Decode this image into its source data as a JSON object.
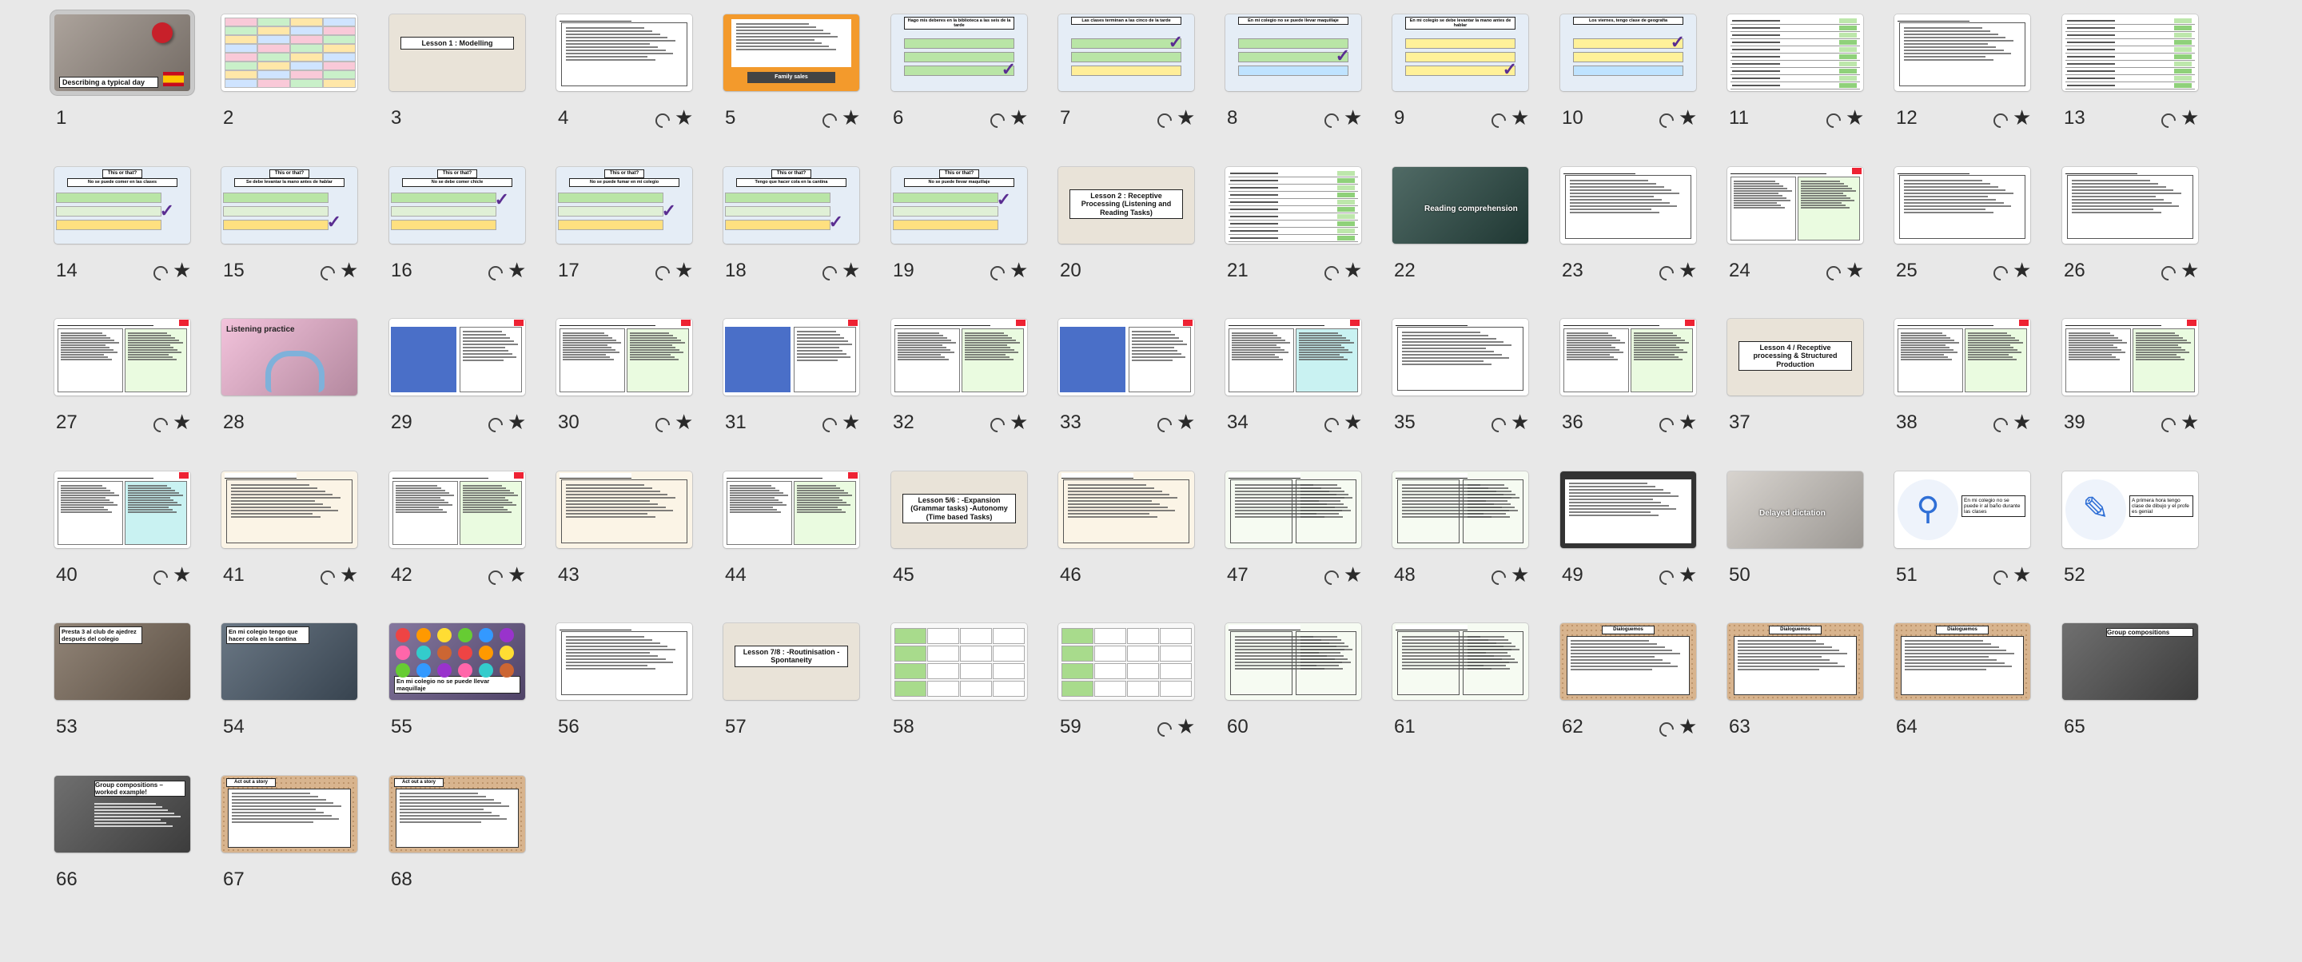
{
  "app": {
    "view": "slide-sorter"
  },
  "selected_slide": 1,
  "slides": [
    {
      "n": "1",
      "kind": "photo-title",
      "title": "Describing a typical day",
      "bg": "#9a8f86",
      "star": false,
      "selected": true
    },
    {
      "n": "2",
      "kind": "table-colour",
      "star": false
    },
    {
      "n": "3",
      "kind": "lesson",
      "title": "Lesson 1 : Modelling",
      "star": false
    },
    {
      "n": "4",
      "kind": "text-box",
      "star": true
    },
    {
      "n": "5",
      "kind": "orange-list",
      "btn": "Family sales",
      "star": true
    },
    {
      "n": "6",
      "kind": "quiz",
      "title": "Hago mis deberes en la biblioteca a las seis de la tarde",
      "tone": "green",
      "star": true
    },
    {
      "n": "7",
      "kind": "quiz",
      "title": "Las clases terminan a las cinco de la tarde",
      "tone": "green-yellow",
      "star": true
    },
    {
      "n": "8",
      "kind": "quiz",
      "title": "En mi colegio no se puede llevar maquillaje",
      "tone": "green-blue",
      "star": true
    },
    {
      "n": "9",
      "kind": "quiz",
      "title": "En mi colegio se debe levantar la mano antes de hablar",
      "tone": "yellow",
      "star": true
    },
    {
      "n": "10",
      "kind": "quiz",
      "title": "Los viernes, tengo clase de geografía",
      "tone": "yellow-blue",
      "star": true
    },
    {
      "n": "11",
      "kind": "word-table",
      "star": true
    },
    {
      "n": "12",
      "kind": "text-box",
      "star": true
    },
    {
      "n": "13",
      "kind": "word-table",
      "star": true
    },
    {
      "n": "14",
      "kind": "thisthat",
      "title": "No se puede comer en las clases",
      "tone": "green-yellow",
      "star": true
    },
    {
      "n": "15",
      "kind": "thisthat",
      "title": "Se debe levantar la mano antes de hablar",
      "tone": "green-yellow",
      "star": true
    },
    {
      "n": "16",
      "kind": "thisthat",
      "title": "No se debe comer chicle",
      "tone": "green-yellow",
      "star": true
    },
    {
      "n": "17",
      "kind": "thisthat",
      "title": "No se puede fumar en mi colegio",
      "tone": "green-yellow",
      "star": true
    },
    {
      "n": "18",
      "kind": "thisthat",
      "title": "Tengo que hacer cola en la cantina",
      "tone": "green-yellow",
      "star": true
    },
    {
      "n": "19",
      "kind": "thisthat",
      "title": "No se puede llevar maquillaje",
      "tone": "green-yellow",
      "star": true
    },
    {
      "n": "20",
      "kind": "lesson",
      "title": "Lesson 2 : Receptive Processing (Listening and Reading Tasks)",
      "star": false
    },
    {
      "n": "21",
      "kind": "word-table",
      "star": true
    },
    {
      "n": "22",
      "kind": "photo-title",
      "title": "Reading comprehension",
      "bg": "#2a4a44",
      "star": false
    },
    {
      "n": "23",
      "kind": "text-box",
      "star": true
    },
    {
      "n": "24",
      "kind": "reading",
      "star": true
    },
    {
      "n": "25",
      "kind": "text-box",
      "star": true
    },
    {
      "n": "26",
      "kind": "text-box",
      "star": true
    },
    {
      "n": "27",
      "kind": "reading",
      "star": true
    },
    {
      "n": "28",
      "kind": "photo-title",
      "title": "Listening practice",
      "bg": "#f0b6d4",
      "star": false
    },
    {
      "n": "29",
      "kind": "blue-panel",
      "star": true
    },
    {
      "n": "30",
      "kind": "reading",
      "star": true
    },
    {
      "n": "31",
      "kind": "blue-panel",
      "star": true
    },
    {
      "n": "32",
      "kind": "reading",
      "star": true
    },
    {
      "n": "33",
      "kind": "blue-panel",
      "star": true
    },
    {
      "n": "34",
      "kind": "reading",
      "star": true
    },
    {
      "n": "35",
      "kind": "text-box",
      "star": true
    },
    {
      "n": "36",
      "kind": "reading",
      "star": true
    },
    {
      "n": "37",
      "kind": "lesson",
      "title": "Lesson 4 / Receptive processing & Structured Production",
      "star": false
    },
    {
      "n": "38",
      "kind": "reading",
      "star": true
    },
    {
      "n": "39",
      "kind": "reading",
      "star": true
    },
    {
      "n": "40",
      "kind": "reading",
      "star": true
    },
    {
      "n": "41",
      "kind": "text-box",
      "star": true
    },
    {
      "n": "42",
      "kind": "reading",
      "star": true
    },
    {
      "n": "43",
      "kind": "text-box",
      "star": false
    },
    {
      "n": "44",
      "kind": "reading",
      "star": false
    },
    {
      "n": "45",
      "kind": "lesson",
      "title": "Lesson 5/6 : -Expansion (Grammar tasks) -Autonomy (Time based Tasks)",
      "star": false
    },
    {
      "n": "46",
      "kind": "text-box",
      "star": false
    },
    {
      "n": "47",
      "kind": "text-box",
      "star": true
    },
    {
      "n": "48",
      "kind": "text-box",
      "star": true
    },
    {
      "n": "49",
      "kind": "dark-list",
      "star": true
    },
    {
      "n": "50",
      "kind": "photo-title",
      "title": "Delayed dictation",
      "bg": "#cfcac4",
      "star": false
    },
    {
      "n": "51",
      "kind": "icon-slide",
      "icon": "sink",
      "text": "En mi colegio no se puede ir al baño durante las clases",
      "star": true
    },
    {
      "n": "52",
      "kind": "icon-slide",
      "icon": "pen",
      "text": "A primera hora tengo clase de dibujo y el profe es genial",
      "star": false
    },
    {
      "n": "53",
      "kind": "photo-title",
      "title": "Presta 3 al club de ajedrez después del colegio",
      "bg": "#7a6a5a",
      "star": false
    },
    {
      "n": "54",
      "kind": "photo-title",
      "title": "En mi colegio tengo que hacer cola en la cantina",
      "bg": "#4a5a6a",
      "star": false
    },
    {
      "n": "55",
      "kind": "photo-title",
      "title": "En mi colegio no se puede llevar maquillaje",
      "bg": "#6a5a8a",
      "star": false
    },
    {
      "n": "56",
      "kind": "text-box",
      "star": false
    },
    {
      "n": "57",
      "kind": "lesson",
      "title": "Lesson 7/8 : -Routinisation -Spontaneity",
      "star": false
    },
    {
      "n": "58",
      "kind": "grid-green",
      "star": false
    },
    {
      "n": "59",
      "kind": "grid-green",
      "star": true
    },
    {
      "n": "60",
      "kind": "text-box",
      "star": false
    },
    {
      "n": "61",
      "kind": "text-box",
      "star": false
    },
    {
      "n": "62",
      "kind": "beige-text",
      "title": "Dialoguemos",
      "star": true
    },
    {
      "n": "63",
      "kind": "beige-text",
      "title": "Dialoguemos",
      "star": false
    },
    {
      "n": "64",
      "kind": "beige-text",
      "title": "Dialoguemos",
      "star": false
    },
    {
      "n": "65",
      "kind": "photo-title",
      "title": "Group compositions",
      "bg": "#505050",
      "star": false
    },
    {
      "n": "66",
      "kind": "photo-title",
      "title": "Group compositions – worked example!",
      "bg": "#505050",
      "star": false
    },
    {
      "n": "67",
      "kind": "beige-text",
      "title": "Act out a story",
      "star": false
    },
    {
      "n": "68",
      "kind": "beige-text",
      "title": "Act out a story",
      "star": false
    }
  ]
}
